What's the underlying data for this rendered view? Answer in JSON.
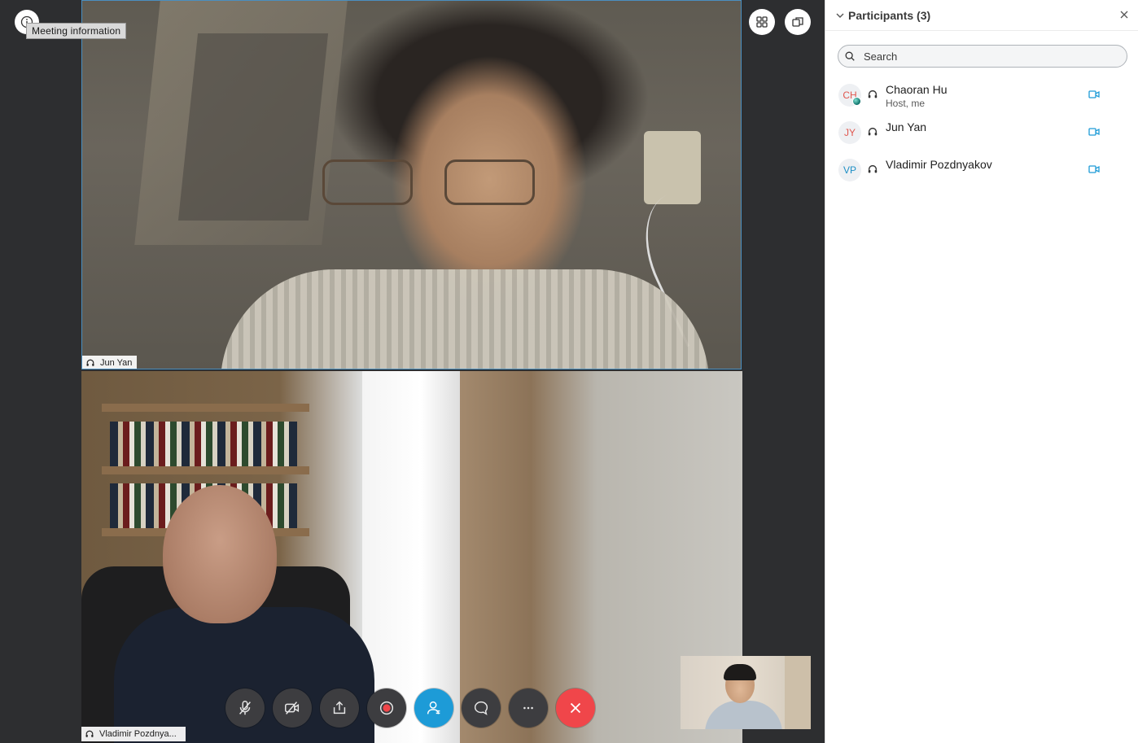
{
  "window": {
    "tooltip": "Meeting information"
  },
  "videos": {
    "top": {
      "name": "Jun Yan"
    },
    "bottom": {
      "name": "Vladimir Pozdnya..."
    }
  },
  "controls": [
    {
      "id": "mute",
      "icon": "mic-off-icon"
    },
    {
      "id": "video",
      "icon": "video-off-icon"
    },
    {
      "id": "share",
      "icon": "share-icon"
    },
    {
      "id": "record",
      "icon": "record-icon"
    },
    {
      "id": "participants",
      "icon": "participants-icon"
    },
    {
      "id": "chat",
      "icon": "chat-icon"
    },
    {
      "id": "more",
      "icon": "more-icon"
    },
    {
      "id": "leave",
      "icon": "close-icon"
    }
  ],
  "panel": {
    "title": "Participants (3)",
    "search_placeholder": "Search",
    "participants": [
      {
        "initials": "CH",
        "name": "Chaoran Hu",
        "role": "Host, me",
        "color": "#e0574f"
      },
      {
        "initials": "JY",
        "name": "Jun Yan",
        "role": "",
        "color": "#e0574f"
      },
      {
        "initials": "VP",
        "name": "Vladimir Pozdnyakov",
        "role": "",
        "color": "#1e8fc6"
      }
    ]
  },
  "colors": {
    "accent": "#1d9bd7",
    "leave": "#f0464a",
    "stage": "#2d2e30"
  }
}
